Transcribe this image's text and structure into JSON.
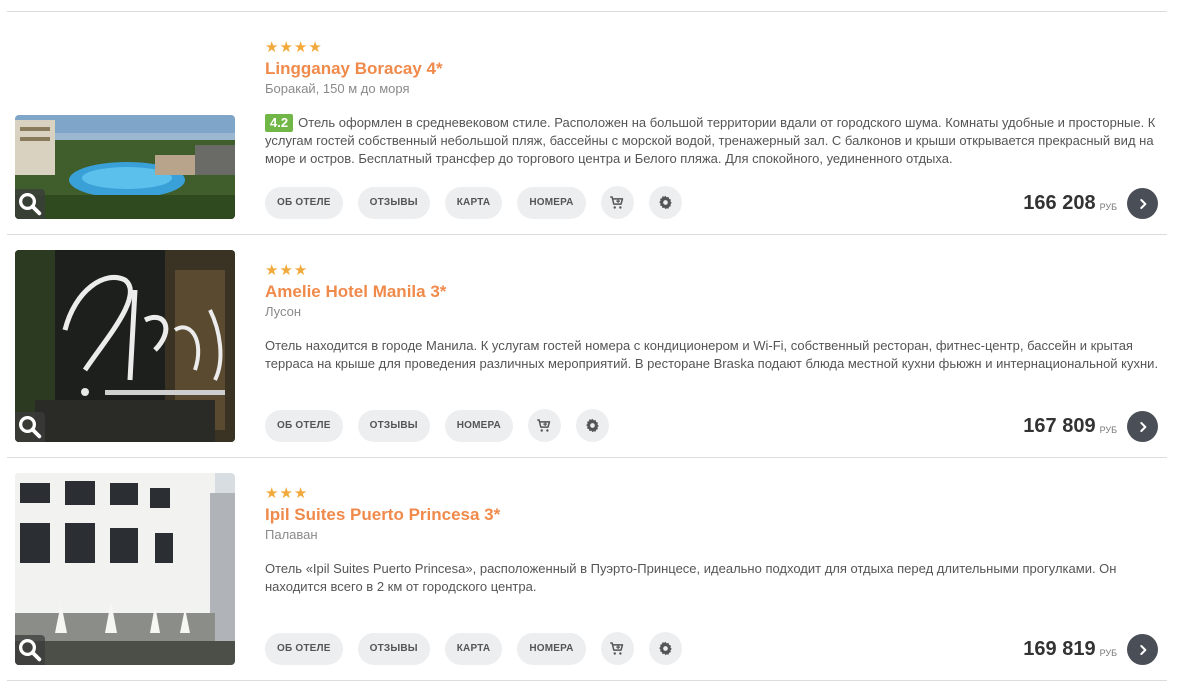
{
  "currency": "руб",
  "buttons": {
    "about": "ОБ ОТЕЛЕ",
    "reviews": "ОТЗЫВЫ",
    "map": "КАРТА",
    "rooms": "НОМЕРА"
  },
  "colors": {
    "title": "#f08a4b",
    "stars": "#f2a93b",
    "rating_badge": "#71b747",
    "go_button": "#4a4f57"
  },
  "hotels": [
    {
      "stars": "★★★★",
      "name": "Lingganay Boracay 4*",
      "location": "Боракай, 150 м до моря",
      "rating": "4.2",
      "description": "Отель оформлен в средневековом стиле. Расположен на большой территории вдали от городского шума. Комнаты удобные и просторные. К услугам гостей собственный небольшой пляж, бассейны с морской водой, тренажерный зал. С балконов и крыши открывается прекрасный вид на море и остров. Бесплатный трансфер до торгового центра и Белого пляжа. Для спокойного, уединенного отдыха.",
      "price": "166 208",
      "icons": [
        "cart-icon",
        "gear-icon"
      ]
    },
    {
      "stars": "★★★",
      "name": "Amelie Hotel Manila 3*",
      "location": "Лусон",
      "description": "Отель находится в городе Манила. К услугам гостей номера с кондиционером и Wi-Fi, собственный ресторан, фитнес-центр, бассейн и крытая терраса на крыше для проведения различных мероприятий. В ресторане Braska подают блюда местной кухни фьюжн и интернациональной кухни.",
      "price": "167 809",
      "icons": [
        "cart-icon",
        "gear-icon"
      ]
    },
    {
      "stars": "★★★",
      "name": "Ipil Suites Puerto Princesa 3*",
      "location": "Палаван",
      "description": "Отель «Ipil Suites Puerto Princesa», расположенный в Пуэрто-Принцесе, идеально подходит для отдыха перед длительными прогулками. Он находится всего в 2 км от городского центра.",
      "price": "169 819",
      "icons": [
        "cart-icon",
        "gear-icon"
      ]
    }
  ]
}
